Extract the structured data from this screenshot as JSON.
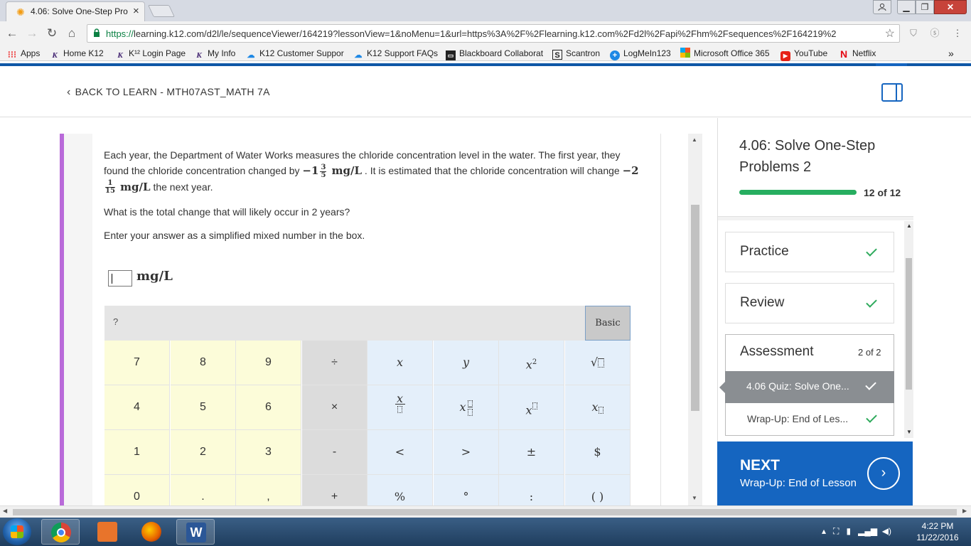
{
  "browser": {
    "tab_title": "4.06: Solve One-Step Pro",
    "url_secure": "https://",
    "url_host": "learning.k12.com",
    "url_rest": "/d2l/le/sequenceViewer/164219?lessonView=1&noMenu=1&url=https%3A%2F%2Flearning.k12.com%2Fd2l%2Fapi%2Fhm%2Fsequences%2F164219%2",
    "bookmarks": [
      {
        "label": "Apps"
      },
      {
        "label": "Home  K12"
      },
      {
        "label": "K¹² Login Page"
      },
      {
        "label": "My Info"
      },
      {
        "label": "K12 Customer Suppor"
      },
      {
        "label": "K12 Support FAQs"
      },
      {
        "label": "Blackboard Collaborat"
      },
      {
        "label": "Scantron"
      },
      {
        "label": "LogMeIn123"
      },
      {
        "label": "Microsoft Office 365"
      },
      {
        "label": "YouTube"
      },
      {
        "label": "Netflix"
      }
    ],
    "overflow": "»"
  },
  "header": {
    "back_label": "BACK TO LEARN - MTH07AST_MATH 7A"
  },
  "question": {
    "p1_a": "Each year, the Department of Water Works measures the chloride concentration level in the water. The first year, they found the chloride concentration changed by",
    "m1_whole": "−1",
    "m1_num": "3",
    "m1_den": "5",
    "m1_unit": "mg/L",
    "p1_b": ". It is estimated that the chloride concentration will change",
    "m2_whole": "−2",
    "m2_num": "1",
    "m2_den": "15",
    "m2_unit": "mg/L",
    "p1_c": "the next year.",
    "p2": "What is the total change that will likely occur in 2 years?",
    "p3": "Enter your answer as a simplified mixed number in the box.",
    "answer_value": "",
    "answer_unit": "mg/L"
  },
  "keypad": {
    "help": "?",
    "mode": "Basic",
    "numbers": [
      "7",
      "8",
      "9",
      "4",
      "5",
      "6",
      "1",
      "2",
      "3",
      "0",
      ".",
      ","
    ],
    "operators": [
      "÷",
      "×",
      "-",
      "+"
    ],
    "functions_row1": [
      "x",
      "y",
      "x",
      "√"
    ],
    "functions_row3": [
      "<",
      ">",
      "±",
      "$"
    ],
    "functions_row4": [
      "%",
      "°",
      ":",
      "( )"
    ],
    "exp": "2"
  },
  "lesson": {
    "title": "4.06: Solve One-Step Problems 2",
    "progress_text": "12 of 12",
    "progress_fraction": 1.0,
    "sections": [
      {
        "label": "Practice",
        "done": true
      },
      {
        "label": "Review",
        "done": true
      }
    ],
    "assessment": {
      "label": "Assessment",
      "count": "2 of 2",
      "items": [
        {
          "label": "4.06 Quiz: Solve One...",
          "done": true,
          "selected": true
        },
        {
          "label": "Wrap-Up: End of Les...",
          "done": true,
          "selected": false
        }
      ]
    },
    "next": {
      "heading": "NEXT",
      "subtitle": "Wrap-Up: End of Lesson"
    }
  },
  "taskbar": {
    "time": "4:22 PM",
    "date": "11/22/2016"
  },
  "colors": {
    "brand_blue": "#1565c0",
    "progress_green": "#27ae60",
    "accent_purple": "#b96ad9",
    "keypad_number_bg": "#fcfcd9",
    "keypad_function_bg": "#e4effa"
  }
}
